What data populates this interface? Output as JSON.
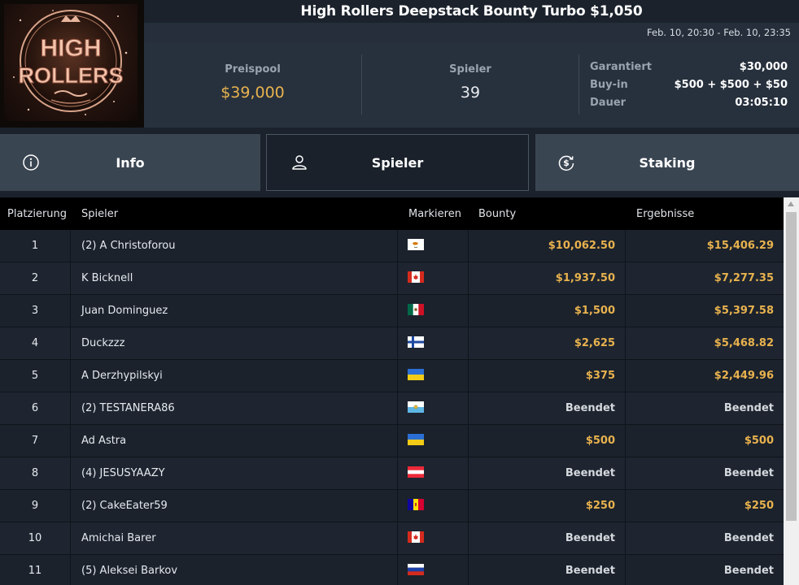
{
  "header": {
    "title": "High Rollers Deepstack Bounty Turbo $1,050",
    "dates": "Feb. 10, 20:30 - Feb. 10, 23:35",
    "logo_text": "HIGH ROLLERS"
  },
  "stats": {
    "prize_label": "Preispool",
    "prize_value": "$39,000",
    "players_label": "Spieler",
    "players_value": "39",
    "details": [
      {
        "label": "Garantiert",
        "value": "$30,000"
      },
      {
        "label": "Buy-in",
        "value": "$500 + $500 + $50"
      },
      {
        "label": "Dauer",
        "value": "03:05:10"
      }
    ]
  },
  "tabs": [
    {
      "label": "Info",
      "icon": "info-circle-icon"
    },
    {
      "label": "Spieler",
      "icon": "user-icon",
      "active": true
    },
    {
      "label": "Staking",
      "icon": "dollar-refresh-icon"
    }
  ],
  "table": {
    "headers": {
      "place": "Platzierung",
      "player": "Spieler",
      "flag": "Markieren",
      "bounty": "Bounty",
      "result": "Ergebnisse"
    },
    "rows": [
      {
        "place": "1",
        "player": "(2) A Christoforou",
        "flag": "cyprus",
        "bounty": "$10,062.50",
        "result": "$15,406.29"
      },
      {
        "place": "2",
        "player": "K Bicknell",
        "flag": "canada",
        "bounty": "$1,937.50",
        "result": "$7,277.35"
      },
      {
        "place": "3",
        "player": "Juan Dominguez",
        "flag": "mexico",
        "bounty": "$1,500",
        "result": "$5,397.58"
      },
      {
        "place": "4",
        "player": "Duckzzz",
        "flag": "finland",
        "bounty": "$2,625",
        "result": "$5,468.82"
      },
      {
        "place": "5",
        "player": "A Derzhypilskyi",
        "flag": "ukraine",
        "bounty": "$375",
        "result": "$2,449.96"
      },
      {
        "place": "6",
        "player": "(2) TESTANERA86",
        "flag": "san-marino",
        "bounty": "Beendet",
        "result": "Beendet"
      },
      {
        "place": "7",
        "player": "Ad Astra",
        "flag": "ukraine",
        "bounty": "$500",
        "result": "$500"
      },
      {
        "place": "8",
        "player": "(4) JESUSYAAZY",
        "flag": "austria",
        "bounty": "Beendet",
        "result": "Beendet"
      },
      {
        "place": "9",
        "player": "(2) CakeEater59",
        "flag": "andorra",
        "bounty": "$250",
        "result": "$250"
      },
      {
        "place": "10",
        "player": "Amichai Barer",
        "flag": "canada",
        "bounty": "Beendet",
        "result": "Beendet"
      },
      {
        "place": "11",
        "player": "(5) Aleksei Barkov",
        "flag": "russia",
        "bounty": "Beendet",
        "result": "Beendet"
      }
    ]
  },
  "colors": {
    "gold": "#e8b24e",
    "background": "#1b222c",
    "panel": "#27313d",
    "tab": "#3a4552"
  }
}
